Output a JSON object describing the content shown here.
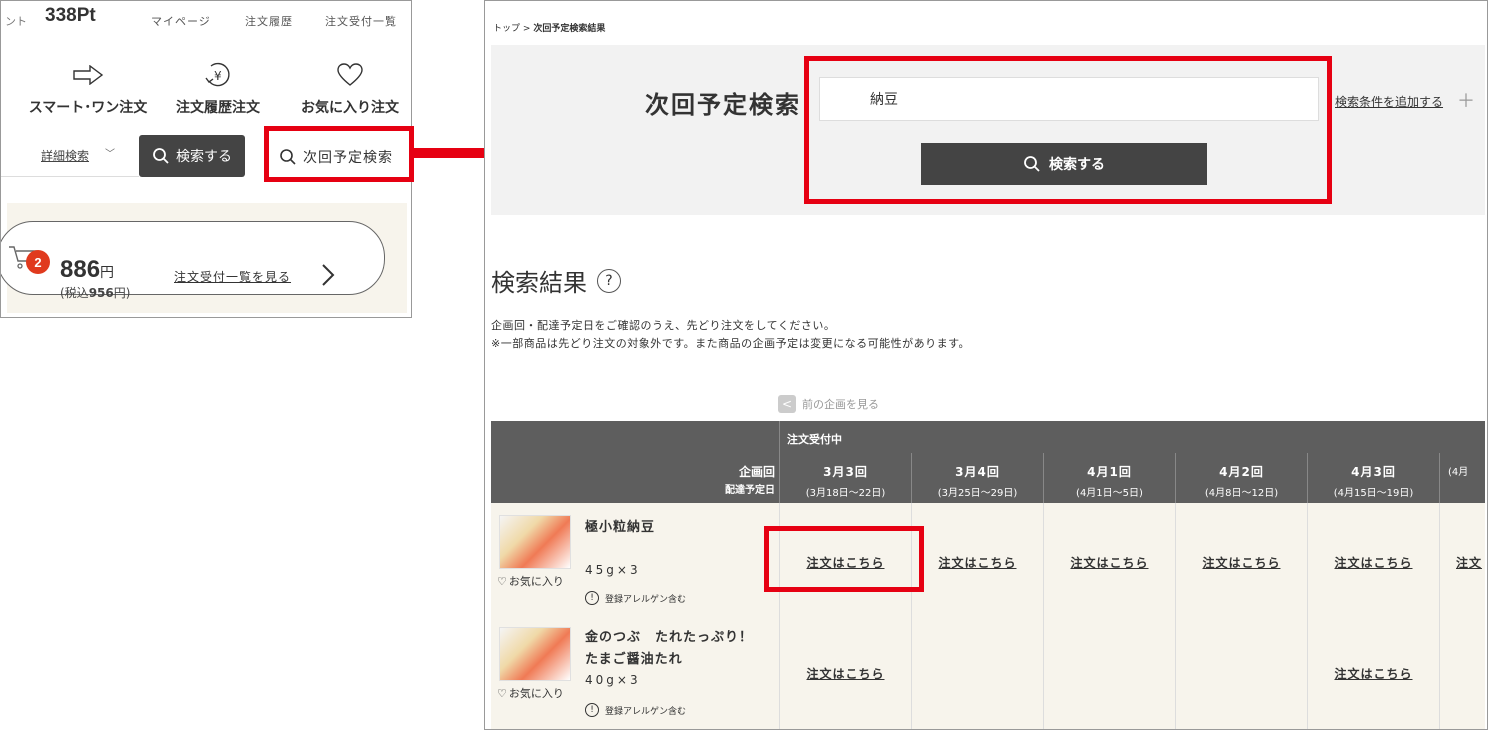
{
  "left_panel": {
    "points_prefix": "ント",
    "points": "338Pt",
    "nav": [
      "マイページ",
      "注文履歴",
      "注文受付一覧"
    ],
    "quick_links": [
      {
        "label": "スマート･ワン注文",
        "icon": "arrow-right-icon"
      },
      {
        "label": "注文履歴注文",
        "icon": "yen-history-icon"
      },
      {
        "label": "お気に入り注文",
        "icon": "heart-icon"
      }
    ],
    "detail_search": "詳細検索",
    "search_button": "検索する",
    "next_schedule_search": "次回予定検索",
    "cart": {
      "badge_count": "2",
      "price": "886",
      "price_unit": "円",
      "tax_prefix": "(税込",
      "tax_price": "956",
      "tax_suffix": "円)",
      "link": "注文受付一覧を見る"
    }
  },
  "right_panel": {
    "breadcrumb": {
      "top": "トップ",
      "separator": ">",
      "current": "次回予定検索結果"
    },
    "search": {
      "title": "次回予定検索",
      "keyword": "納豆",
      "button": "検索する",
      "add_condition": "検索条件を追加する",
      "add_icon": "plus-icon"
    },
    "results_heading": "検索結果",
    "help_mark": "?",
    "note1": "企画回・配達予定日をご確認のうえ、先どり注文をしてください。",
    "note2": "※一部商品は先どり注文の対象外です。また商品の企画予定は変更になる可能性があります。",
    "prev_plan": "前の企画を見る",
    "table": {
      "accepting_label": "注文受付中",
      "header_round": "企画回",
      "header_date": "配達予定日",
      "columns": [
        {
          "round": "3月3回",
          "dates": "(3月18日～22日)"
        },
        {
          "round": "3月4回",
          "dates": "(3月25日～29日)"
        },
        {
          "round": "4月1回",
          "dates": "(4月1日～5日)"
        },
        {
          "round": "4月2回",
          "dates": "(4月8日～12日)"
        },
        {
          "round": "4月3回",
          "dates": "(4月15日～19日)"
        },
        {
          "round": "",
          "dates": "(4月"
        }
      ],
      "order_link": "注文はこちら",
      "order_link_cut": "注文",
      "favorite": "お気に入り",
      "allergen_note": "登録アレルゲン含む",
      "rows": [
        {
          "name_line1": "極小粒納豆",
          "name_line2": "",
          "size": "45g×3"
        },
        {
          "name_line1": "金のつぶ　たれたっぷり！",
          "name_line2": "たまご醤油たれ",
          "size": "40g×3"
        }
      ]
    }
  },
  "colors": {
    "highlight": "#e60012",
    "dark_button": "#444444",
    "header_bg": "#5e5e5e",
    "row_bg": "#f7f4ec",
    "badge": "#e03a1e"
  }
}
